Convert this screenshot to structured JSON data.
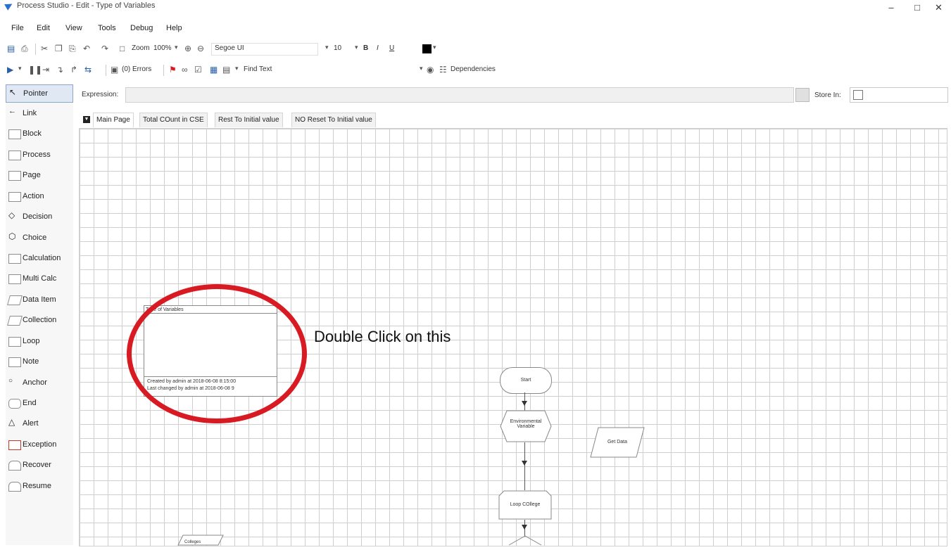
{
  "window": {
    "title": "Process Studio  - Edit - Type of Variables",
    "minimize": "–",
    "maximize": "□",
    "close": "✕"
  },
  "menu": [
    "File",
    "Edit",
    "View",
    "Tools",
    "Debug",
    "Help"
  ],
  "toolbar": {
    "zoom_label": "Zoom",
    "zoom_value": "100%",
    "font_name": "Segoe UI",
    "font_size": "10",
    "bold": "B",
    "italic": "I",
    "underline": "U",
    "errors": "(0) Errors",
    "find_text": "Find Text",
    "dependencies": "Dependencies"
  },
  "palette": [
    {
      "label": "Pointer"
    },
    {
      "label": "Link"
    },
    {
      "label": "Block"
    },
    {
      "label": "Process"
    },
    {
      "label": "Page"
    },
    {
      "label": "Action"
    },
    {
      "label": "Decision"
    },
    {
      "label": "Choice"
    },
    {
      "label": "Calculation"
    },
    {
      "label": "Multi Calc"
    },
    {
      "label": "Data Item"
    },
    {
      "label": "Collection"
    },
    {
      "label": "Loop"
    },
    {
      "label": "Note"
    },
    {
      "label": "Anchor"
    },
    {
      "label": "End"
    },
    {
      "label": "Alert"
    },
    {
      "label": "Exception"
    },
    {
      "label": "Recover"
    },
    {
      "label": "Resume"
    }
  ],
  "expression": {
    "label": "Expression:",
    "value": "",
    "store_label": "Store In:",
    "store_value": ""
  },
  "tabs": [
    "Main Page",
    "Total COunt in CSE",
    "Rest To Initial value",
    "NO Reset To Initial value"
  ],
  "info_box": {
    "title": "Type of Variables",
    "created": "Created by admin at 2018-06-08 8:15:00",
    "changed": "Last changed by admin at 2018-06-08 9"
  },
  "annotation": "Double Click on this",
  "flow": {
    "start": "Start",
    "env": "Environmental Variable",
    "get_data": "Get Data",
    "loop": "Loop COllege",
    "collection": "Colleges"
  },
  "colors": {
    "highlight": "#d81b22",
    "grid": "#cfcfcf"
  }
}
